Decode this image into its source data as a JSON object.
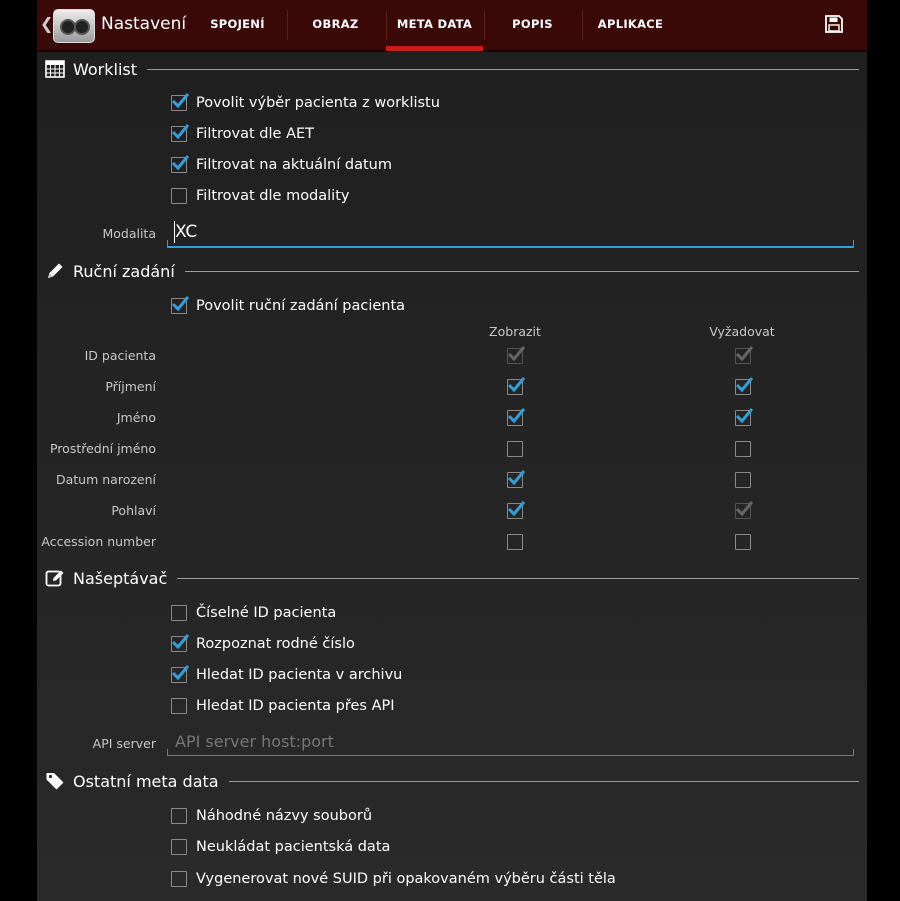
{
  "actionbar": {
    "title": "Nastavení",
    "tabs": [
      {
        "label": "SPOJENÍ"
      },
      {
        "label": "OBRAZ"
      },
      {
        "label": "META DATA"
      },
      {
        "label": "POPIS"
      },
      {
        "label": "APLIKACE"
      }
    ],
    "active_tab": "META DATA",
    "accent_color": "#cc1b1b",
    "bar_color": "#3b0808"
  },
  "worklist": {
    "title": "Worklist",
    "icon": "calendar-icon",
    "options": [
      {
        "label": "Povolit výběr pacienta z worklistu",
        "checked": true
      },
      {
        "label": "Filtrovat dle AET",
        "checked": true
      },
      {
        "label": "Filtrovat na aktuální datum",
        "checked": true
      },
      {
        "label": "Filtrovat dle modality",
        "checked": false
      }
    ],
    "modality_label": "Modalita",
    "modality_value": "XC"
  },
  "manual": {
    "title": "Ruční zadání",
    "icon": "pencil-icon",
    "enable_label": "Povolit ruční zadání pacienta",
    "enable_checked": true,
    "col_show": "Zobrazit",
    "col_require": "Vyžadovat",
    "rows": [
      {
        "label": "ID pacienta",
        "show": true,
        "require": true,
        "disabled": true
      },
      {
        "label": "Příjmení",
        "show": true,
        "require": true,
        "disabled": false
      },
      {
        "label": "Jméno",
        "show": true,
        "require": true,
        "disabled": false
      },
      {
        "label": "Prostřední jméno",
        "show": false,
        "require": false,
        "disabled": false
      },
      {
        "label": "Datum narození",
        "show": true,
        "require": false,
        "disabled": false
      },
      {
        "label": "Pohlaví",
        "show": true,
        "require": true,
        "disabled_require": true
      },
      {
        "label": "Accession number",
        "show": false,
        "require": false,
        "disabled": false
      }
    ]
  },
  "suggest": {
    "title": "Našeptávač",
    "icon": "edit-icon",
    "options": [
      {
        "label": "Číselné ID pacienta",
        "checked": false
      },
      {
        "label": "Rozpoznat rodné číslo",
        "checked": true
      },
      {
        "label": "Hledat ID pacienta v archivu",
        "checked": true
      },
      {
        "label": "Hledat ID pacienta přes API",
        "checked": false
      }
    ],
    "api_label": "API server",
    "api_placeholder": "API server host:port"
  },
  "other": {
    "title": "Ostatní meta data",
    "icon": "tag-icon",
    "options": [
      {
        "label": "Náhodné názvy souborů",
        "checked": false
      },
      {
        "label": "Neukládat pacientská data",
        "checked": false
      },
      {
        "label": "Vygenerovat nové SUID při opakovaném výběru části těla",
        "checked": false
      }
    ]
  }
}
